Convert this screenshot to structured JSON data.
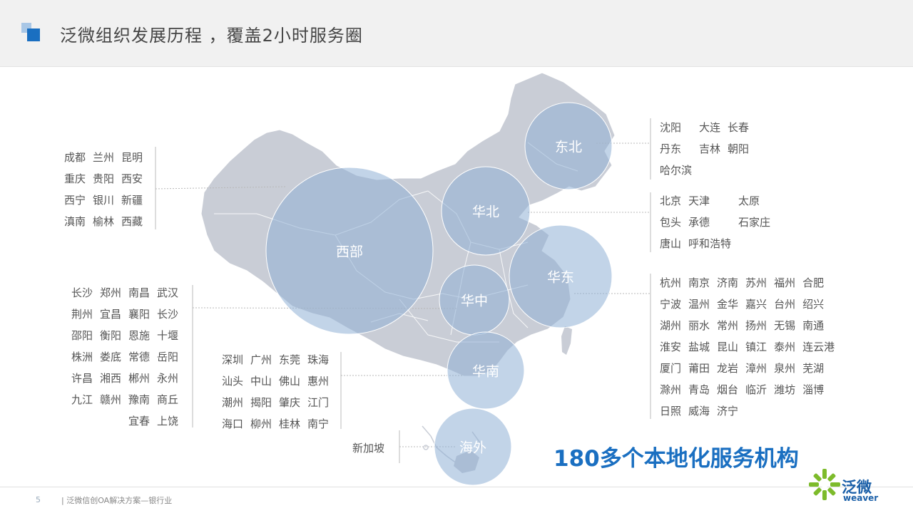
{
  "header": {
    "title": "泛微组织发展历程 ，覆盖2小时服务圈"
  },
  "regions": [
    {
      "key": "dongbei",
      "label": "东北"
    },
    {
      "key": "huabei",
      "label": "华北"
    },
    {
      "key": "xibu",
      "label": "西部"
    },
    {
      "key": "huadong",
      "label": "华东"
    },
    {
      "key": "huazhong",
      "label": "华中"
    },
    {
      "key": "huanan",
      "label": "华南"
    },
    {
      "key": "haiwai",
      "label": "海外"
    }
  ],
  "cities": {
    "xibu": [
      "成都",
      "兰州",
      "昆明",
      "重庆",
      "贵阳",
      "西安",
      "西宁",
      "银川",
      "新疆",
      "滇南",
      "榆林",
      "西藏"
    ],
    "dongbei": [
      "沈阳",
      "大连",
      "长春",
      "丹东",
      "吉林",
      "朝阳",
      "哈尔滨"
    ],
    "huabei": [
      "北京",
      "天津",
      "太原",
      "包头",
      "承德",
      "石家庄",
      "唐山",
      "呼和浩特"
    ],
    "huazhong": [
      "长沙",
      "郑州",
      "南昌",
      "武汉",
      "荆州",
      "宜昌",
      "襄阳",
      "长沙",
      "邵阳",
      "衡阳",
      "恩施",
      "十堰",
      "株洲",
      "娄底",
      "常德",
      "岳阳",
      "许昌",
      "湘西",
      "郴州",
      "永州",
      "九江",
      "赣州",
      "豫南",
      "商丘",
      "",
      "",
      "宜春",
      "上饶"
    ],
    "huanan": [
      "深圳",
      "广州",
      "东莞",
      "珠海",
      "汕头",
      "中山",
      "佛山",
      "惠州",
      "潮州",
      "揭阳",
      "肇庆",
      "江门",
      "海口",
      "柳州",
      "桂林",
      "南宁"
    ],
    "huadong": [
      "杭州",
      "南京",
      "济南",
      "苏州",
      "福州",
      "合肥",
      "宁波",
      "温州",
      "金华",
      "嘉兴",
      "台州",
      "绍兴",
      "湖州",
      "丽水",
      "常州",
      "扬州",
      "无锡",
      "南通",
      "淮安",
      "盐城",
      "昆山",
      "镇江",
      "泰州",
      "连云港",
      "厦门",
      "莆田",
      "龙岩",
      "漳州",
      "泉州",
      "芜湖",
      "滁州",
      "青岛",
      "烟台",
      "临沂",
      "潍坊",
      "淄博",
      "日照",
      "威海",
      "济宁"
    ],
    "haiwai": [
      "新加坡"
    ]
  },
  "stat": "180多个本地化服务机构",
  "footer": {
    "page": "5",
    "text": "| 泛微信创OA解决方案—银行业"
  },
  "logo": {
    "cn": "泛微",
    "en": "weaver"
  },
  "colors": {
    "accent": "#1a6fc1",
    "map": "#c9cdd6",
    "circle": "#8fb0d6"
  }
}
